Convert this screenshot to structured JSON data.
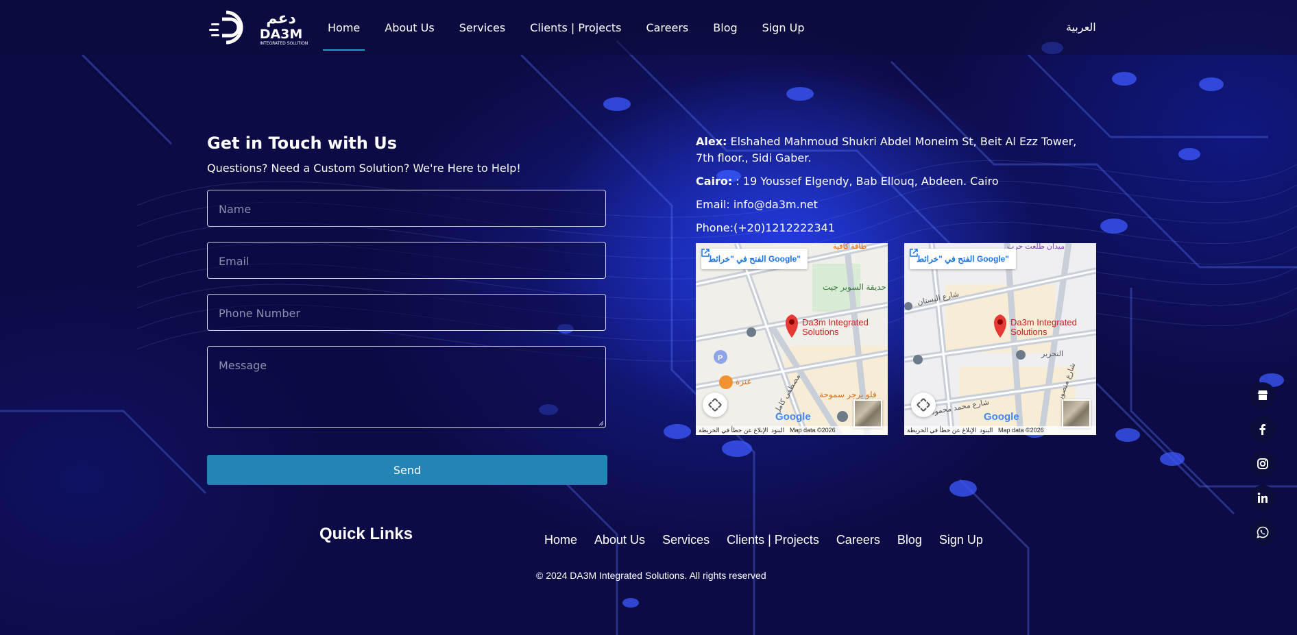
{
  "header": {
    "logo_arabic": "دعم",
    "logo_text": "DA3M",
    "logo_tagline": "INTEGRATED SOLUTION",
    "nav": [
      "Home",
      "About Us",
      "Services",
      "Clients | Projects",
      "Careers",
      "Blog",
      "Sign Up"
    ],
    "active_nav": "Home",
    "language": "العربية"
  },
  "contact": {
    "title": "Get in Touch with Us",
    "subtitle": "Questions? Need a Custom Solution? We're Here to Help!",
    "placeholders": {
      "name": "Name",
      "email": "Email",
      "phone": "Phone Number",
      "message": "Message"
    },
    "send_label": "Send"
  },
  "info": {
    "alex_label": "Alex:",
    "alex_address": "Elshahed Mahmoud Shukri Abdel Moneim St, Beit Al Ezz Tower, 7th floor., Sidi Gaber.",
    "cairo_label": "Cairo:",
    "cairo_address": ": 19 Youssef Elgendy, Bab Ellouq, Abdeen. Cairo",
    "email": "Email: info@da3m.net",
    "phone": "Phone:(+20)1212222341"
  },
  "maps": [
    {
      "open_label": "الفتح في \"خرائط Google\"",
      "place": "Da3m Integrated Solutions",
      "labels": [
        "حديقة السوبر جيت",
        "عنزة",
        "فلو برجر سموحة",
        "مصطفى كامل",
        "طاقة كافية"
      ],
      "credit_report": "الإبلاغ عن خطأ في الخريطة",
      "credit_terms": "البنود",
      "credit_data": "Map data ©2026",
      "google": "Google"
    },
    {
      "open_label": "الفتح في \"خرائط Google\"",
      "place": "Da3m Integrated Solutions",
      "labels": [
        "شارع البستان",
        "التحرير",
        "شارع محمد محمود",
        "شارع منصور",
        "ميدان طلعت حرب"
      ],
      "credit_report": "الإبلاغ عن خطأ في الخريطة",
      "credit_terms": "البنود",
      "credit_data": "Map data ©2026",
      "google": "Google"
    }
  ],
  "footer": {
    "quick_links_title": "Quick Links",
    "links": [
      "Home",
      "About Us",
      "Services",
      "Clients | Projects",
      "Careers",
      "Blog",
      "Sign Up"
    ],
    "copyright": "© 2024 DA3M Integrated Solutions. All rights reserved"
  },
  "social": [
    "store-icon",
    "facebook-icon",
    "instagram-icon",
    "linkedin-icon",
    "whatsapp-icon"
  ],
  "colors": {
    "background": "#0d0b45",
    "accent": "#2384b5",
    "nav_underline": "#1fa0c8"
  }
}
